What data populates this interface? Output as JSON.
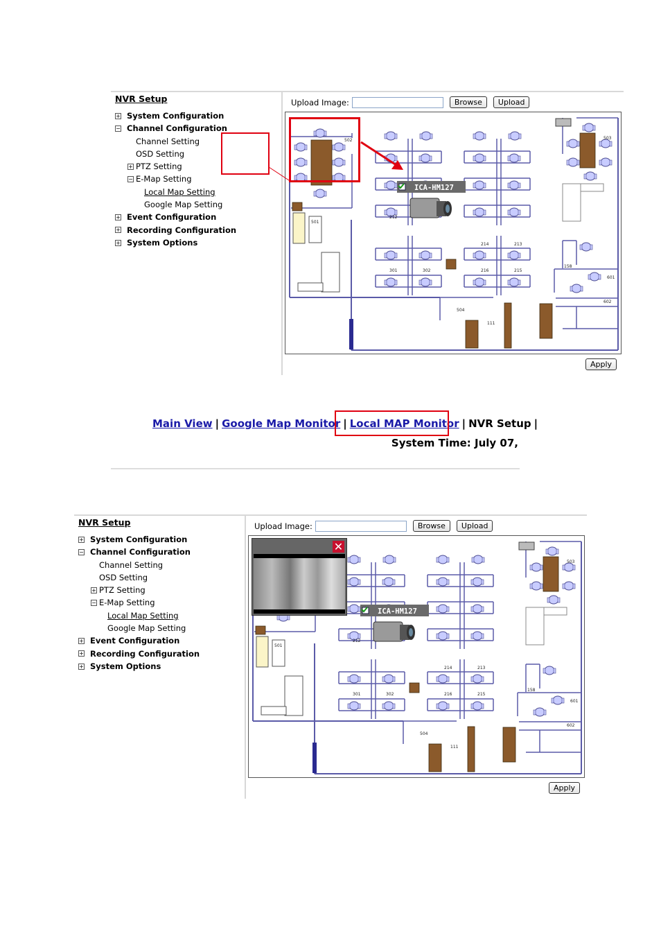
{
  "sidebar": {
    "title": "NVR Setup",
    "items": [
      {
        "label": "System Configuration",
        "expander": "+"
      },
      {
        "label": "Channel Configuration",
        "expander": "−"
      },
      {
        "label": "Channel Setting"
      },
      {
        "label": "OSD Setting"
      },
      {
        "label": "PTZ Setting",
        "expander": "+"
      },
      {
        "label": "E-Map Setting",
        "expander": "−"
      },
      {
        "label": "Local Map Setting"
      },
      {
        "label": "Google Map Setting"
      },
      {
        "label": "Event Configuration",
        "expander": "+"
      },
      {
        "label": "Recording Configuration",
        "expander": "+"
      },
      {
        "label": "System Options",
        "expander": "+"
      }
    ]
  },
  "upload": {
    "label": "Upload Image:",
    "value": "",
    "browse": "Browse",
    "upload": "Upload"
  },
  "apply": "Apply",
  "map": {
    "camera_label": "ICA-HM127",
    "camera_checked": true,
    "rooms": [
      "502",
      "501",
      "212",
      "301",
      "302",
      "214",
      "213",
      "216",
      "215",
      "503",
      "158",
      "601",
      "602",
      "504",
      "111"
    ]
  },
  "popup": {
    "close": "✕"
  },
  "nav": {
    "links": [
      "Main View",
      "Google Map Monitor",
      "Local MAP Monitor"
    ],
    "current": "NVR Setup",
    "separator": "|",
    "system_time": "System Time: July 07,"
  },
  "colors": {
    "highlight": "#e00010",
    "link": "#1a1aa8",
    "wall": "#5a5aa8",
    "desk": "#8b5a2b",
    "chair": "#c8ccff"
  }
}
